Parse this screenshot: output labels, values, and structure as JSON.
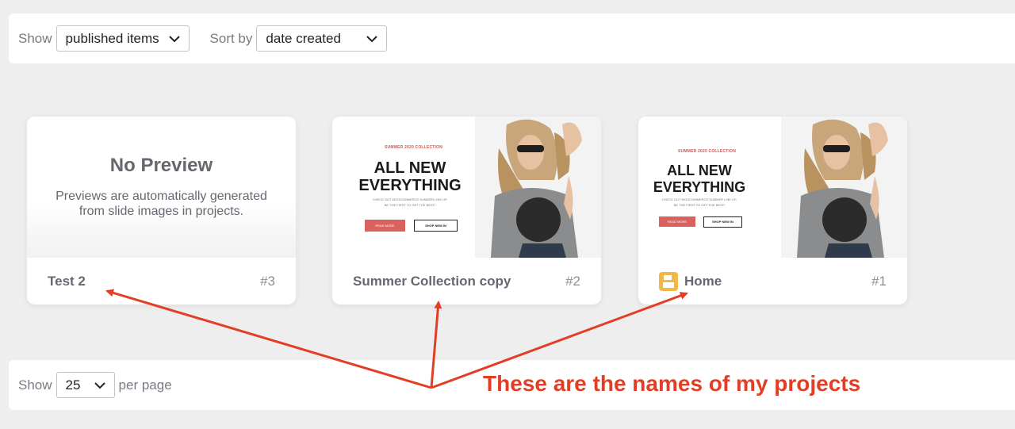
{
  "filters": {
    "show_label": "Show",
    "show_value": "published items",
    "sort_label": "Sort by",
    "sort_value": "date created"
  },
  "projects": [
    {
      "name": "Test 2",
      "number": "#3",
      "preview": "none",
      "no_preview_title": "No Preview",
      "no_preview_text": "Previews are automatically generated from slide images in projects."
    },
    {
      "name": "Summer Collection copy",
      "number": "#2",
      "preview": "slide",
      "slide": {
        "kicker": "SUMMER 2020 COLLECTION",
        "headline_1": "ALL NEW",
        "headline_2": "EVERYTHING",
        "sub_1": "CHECK OUT WOOCOMMERCE SUMMER LINE UP.",
        "sub_2": "BE THE FIRST TO GET THE BEST!",
        "btn_1": "READ MORE",
        "btn_2": "SHOP NEW IN"
      }
    },
    {
      "name": "Home",
      "number": "#1",
      "preview": "slide",
      "icon": "save-icon",
      "slide": {
        "kicker": "SUMMER 2020 COLLECTION",
        "headline_1": "ALL NEW",
        "headline_2": "EVERYTHING",
        "sub_1": "CHECK OUT WOOCOMMERCE SUMMER LINE UP.",
        "sub_2": "BE THE FIRST TO GET THE BEST!",
        "btn_1": "READ MORE",
        "btn_2": "SHOP NEW IN"
      }
    }
  ],
  "pagination": {
    "show_label": "Show",
    "per_page_value": "25",
    "per_page_label": "per page"
  },
  "annotation": {
    "text": "These are the names of my projects",
    "color": "#e33e25"
  },
  "colors": {
    "background": "#eeeeee",
    "slide_accent": "#d9625e",
    "save_icon": "#f0b849"
  }
}
